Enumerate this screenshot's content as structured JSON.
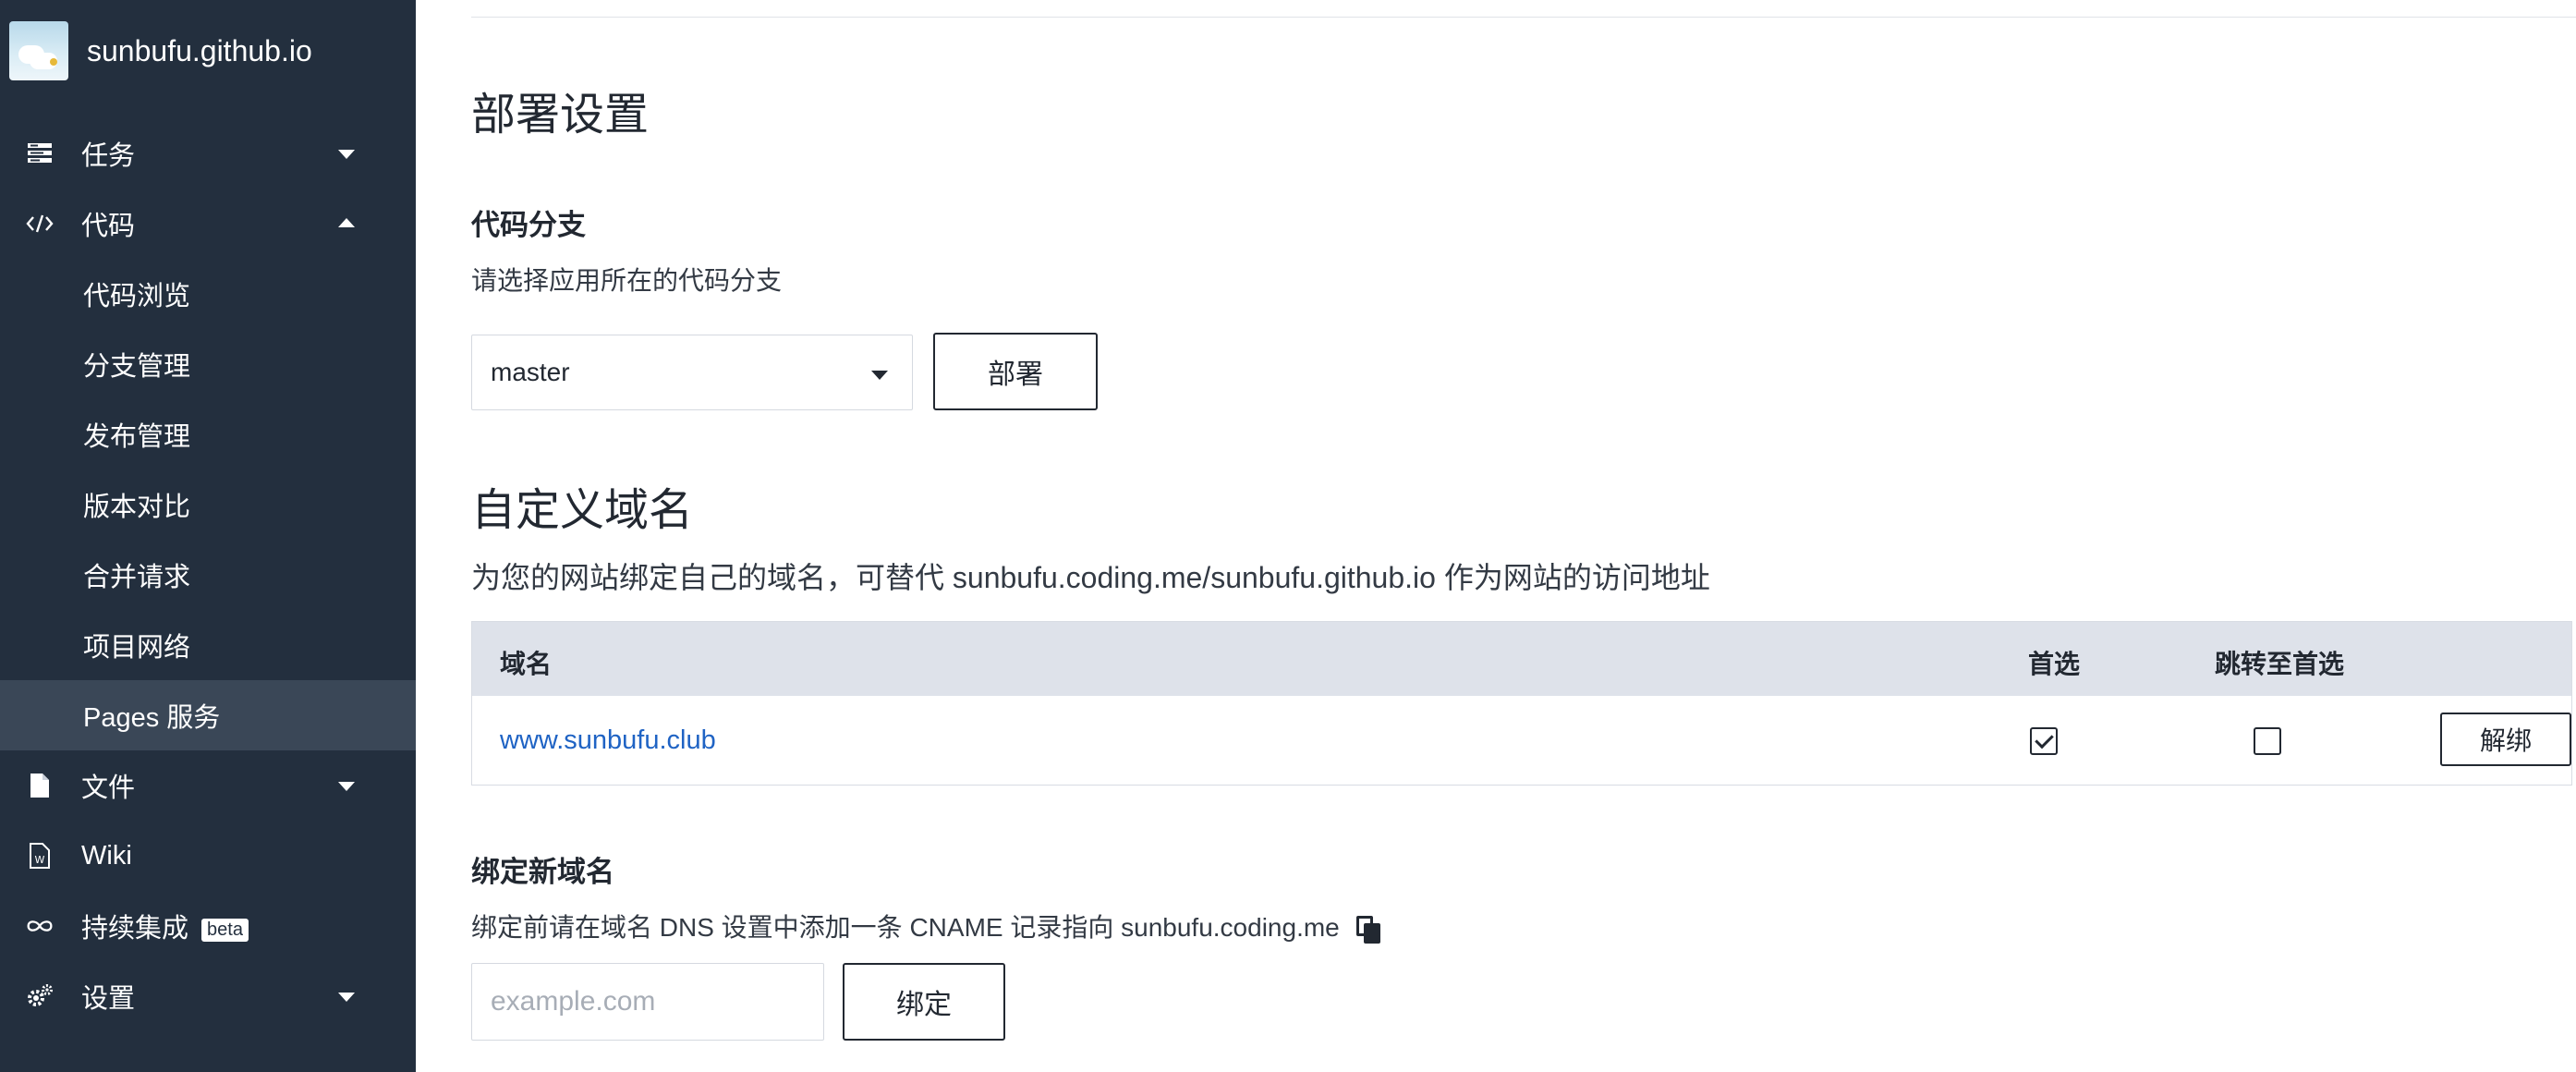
{
  "sidebar": {
    "project_name": "sunbufu.github.io",
    "items": [
      {
        "label": "任务",
        "icon": "tasks-icon",
        "expanded": false
      },
      {
        "label": "代码",
        "icon": "code-icon",
        "expanded": true
      },
      {
        "label": "文件",
        "icon": "file-icon",
        "expanded": false
      },
      {
        "label": "Wiki",
        "icon": "wiki-icon"
      },
      {
        "label": "持续集成",
        "icon": "infinity-icon",
        "badge": "beta"
      },
      {
        "label": "设置",
        "icon": "settings-gears-icon",
        "expanded": false
      }
    ],
    "code_sub_items": [
      "代码浏览",
      "分支管理",
      "发布管理",
      "版本对比",
      "合并请求",
      "项目网络",
      "Pages 服务"
    ],
    "active_sub_item": "Pages 服务"
  },
  "deploy": {
    "title": "部署设置",
    "branch_heading": "代码分支",
    "branch_desc": "请选择应用所在的代码分支",
    "branch_selected": "master",
    "deploy_button": "部署"
  },
  "custom_domain": {
    "title": "自定义域名",
    "desc": "为您的网站绑定自己的域名，可替代 sunbufu.coding.me/sunbufu.github.io 作为网站的访问地址",
    "columns": [
      "域名",
      "首选",
      "跳转至首选"
    ],
    "rows": [
      {
        "domain": "www.sunbufu.club",
        "preferred": true,
        "redirect": false,
        "action": "解绑"
      }
    ]
  },
  "bind": {
    "heading": "绑定新域名",
    "desc": "绑定前请在域名 DNS 设置中添加一条 CNAME 记录指向 sunbufu.coding.me",
    "placeholder": "example.com",
    "button": "绑定"
  },
  "colors": {
    "sidebar_bg": "#232f3e",
    "sidebar_active_bg": "#3a4757",
    "link": "#1f63c4",
    "table_header_bg": "#dee2ea"
  }
}
